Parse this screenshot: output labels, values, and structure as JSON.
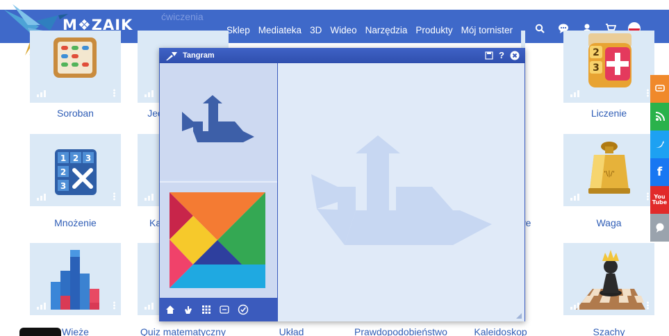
{
  "header": {
    "faded_title": "ćwiczenia",
    "brand": "M❖ZAIK",
    "nav": [
      "Sklep",
      "Mediateka",
      "3D",
      "Wideo",
      "Narzędzia",
      "Produkty",
      "Mój tornister"
    ],
    "icons": [
      "search-icon",
      "chat-icon",
      "user-icon",
      "cart-icon",
      "flag-poland-icon"
    ]
  },
  "tiles": {
    "r1c1": "Soroban",
    "r1c2": "Jed",
    "r1c6": "Liczenie",
    "r2c1": "Mnożenie",
    "r2c2": "Ka",
    "r2c5": "we",
    "r2c6": "Waga",
    "r3c1": "Wieże",
    "r3c2": "Quiz matematyczny",
    "r3c3": "Układ",
    "r3c4": "Prawdopodobieństwo",
    "r3c5": "Kaleidoskop",
    "r3c6": "Szachy"
  },
  "share": [
    "comment-icon",
    "rss-icon",
    "twitter-icon",
    "facebook-icon",
    "youtube-icon",
    "help-icon"
  ],
  "tangram": {
    "title": "Tangram",
    "title_icons": [
      "save-icon",
      "help-icon",
      "close-icon"
    ],
    "toolbar_icons": [
      "home-icon",
      "hand-icon",
      "grid-icon",
      "list-icon",
      "check-icon"
    ]
  },
  "colors": {
    "navbar": "#3f69c9",
    "tile_bg": "#dbe9f6",
    "label": "#2f5db6",
    "window": "#3b5bbd",
    "silhouette": "#3d5fa8",
    "silhouette_faint": "#c7d7f2"
  }
}
